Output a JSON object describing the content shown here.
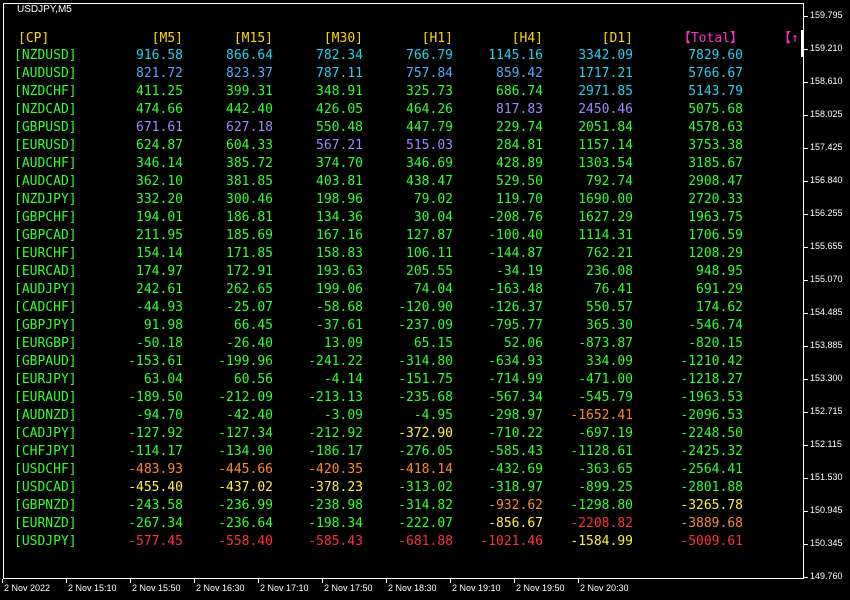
{
  "window": {
    "title": "USDJPY,M5"
  },
  "colors": {
    "header": "#ffd700",
    "total_header": "#ff33cc",
    "symbol": "#33ff33",
    "cyan": "#22d3ee",
    "blue": "#55aaff",
    "violet": "#9b8cff",
    "green": "#33ff33",
    "yellow": "#ffee44",
    "orange": "#ff8833",
    "red": "#ff3333",
    "white": "#ffffff"
  },
  "price_scale": [
    "159.795",
    "159.210",
    "158.610",
    "158.025",
    "157.425",
    "156.840",
    "156.255",
    "155.655",
    "155.070",
    "154.485",
    "153.885",
    "153.300",
    "152.715",
    "152.115",
    "151.530",
    "150.945",
    "150.345",
    "149.760"
  ],
  "time_scale": [
    "2 Nov 2022",
    "2 Nov 15:10",
    "2 Nov 15:50",
    "2 Nov 16:30",
    "2 Nov 17:10",
    "2 Nov 17:50",
    "2 Nov 18:30",
    "2 Nov 19:10",
    "2 Nov 19:50",
    "2 Nov 20:30"
  ],
  "table": {
    "headers": [
      "[CP]",
      "[M5]",
      "[M15]",
      "[M30]",
      "[H1]",
      "[H4]",
      "[D1]",
      "【Total】",
      "【↑"
    ],
    "rows": [
      {
        "symbol": "[NZDUSD]",
        "values": [
          "916.58",
          "866.64",
          "782.34",
          "766.79",
          "1145.16",
          "3342.09",
          "7829.60"
        ],
        "colors": [
          "cyan",
          "cyan",
          "cyan",
          "cyan",
          "cyan",
          "cyan",
          "cyan"
        ]
      },
      {
        "symbol": "[AUDUSD]",
        "values": [
          "821.72",
          "823.37",
          "787.11",
          "757.84",
          "859.42",
          "1717.21",
          "5766.67"
        ],
        "colors": [
          "blue",
          "blue",
          "cyan",
          "blue",
          "blue",
          "cyan",
          "cyan"
        ]
      },
      {
        "symbol": "[NZDCHF]",
        "values": [
          "411.25",
          "399.31",
          "348.91",
          "325.73",
          "686.74",
          "2971.85",
          "5143.79"
        ],
        "colors": [
          "green",
          "green",
          "green",
          "green",
          "green",
          "cyan",
          "cyan"
        ]
      },
      {
        "symbol": "[NZDCAD]",
        "values": [
          "474.66",
          "442.40",
          "426.05",
          "464.26",
          "817.83",
          "2450.46",
          "5075.68"
        ],
        "colors": [
          "green",
          "green",
          "green",
          "green",
          "violet",
          "violet",
          "green"
        ]
      },
      {
        "symbol": "[GBPUSD]",
        "values": [
          "671.61",
          "627.18",
          "550.48",
          "447.79",
          "229.74",
          "2051.84",
          "4578.63"
        ],
        "colors": [
          "violet",
          "violet",
          "green",
          "green",
          "green",
          "green",
          "green"
        ]
      },
      {
        "symbol": "[EURUSD]",
        "values": [
          "624.87",
          "604.33",
          "567.21",
          "515.03",
          "284.81",
          "1157.14",
          "3753.38"
        ],
        "colors": [
          "green",
          "green",
          "violet",
          "violet",
          "green",
          "green",
          "green"
        ]
      },
      {
        "symbol": "[AUDCHF]",
        "values": [
          "346.14",
          "385.72",
          "374.70",
          "346.69",
          "428.89",
          "1303.54",
          "3185.67"
        ],
        "colors": [
          "green",
          "green",
          "green",
          "green",
          "green",
          "green",
          "green"
        ]
      },
      {
        "symbol": "[AUDCAD]",
        "values": [
          "362.10",
          "381.85",
          "403.81",
          "438.47",
          "529.50",
          "792.74",
          "2908.47"
        ],
        "colors": [
          "green",
          "green",
          "green",
          "green",
          "green",
          "green",
          "green"
        ]
      },
      {
        "symbol": "[NZDJPY]",
        "values": [
          "332.20",
          "300.46",
          "198.96",
          "79.02",
          "119.70",
          "1690.00",
          "2720.33"
        ],
        "colors": [
          "green",
          "green",
          "green",
          "green",
          "green",
          "green",
          "green"
        ]
      },
      {
        "symbol": "[GBPCHF]",
        "values": [
          "194.01",
          "186.81",
          "134.36",
          "30.04",
          "-208.76",
          "1627.29",
          "1963.75"
        ],
        "colors": [
          "green",
          "green",
          "green",
          "green",
          "green",
          "green",
          "green"
        ]
      },
      {
        "symbol": "[GBPCAD]",
        "values": [
          "211.95",
          "185.69",
          "167.16",
          "127.87",
          "-100.40",
          "1114.31",
          "1706.59"
        ],
        "colors": [
          "green",
          "green",
          "green",
          "green",
          "green",
          "green",
          "green"
        ]
      },
      {
        "symbol": "[EURCHF]",
        "values": [
          "154.14",
          "171.85",
          "158.83",
          "106.11",
          "-144.87",
          "762.21",
          "1208.29"
        ],
        "colors": [
          "green",
          "green",
          "green",
          "green",
          "green",
          "green",
          "green"
        ]
      },
      {
        "symbol": "[EURCAD]",
        "values": [
          "174.97",
          "172.91",
          "193.63",
          "205.55",
          "-34.19",
          "236.08",
          "948.95"
        ],
        "colors": [
          "green",
          "green",
          "green",
          "green",
          "green",
          "green",
          "green"
        ]
      },
      {
        "symbol": "[AUDJPY]",
        "values": [
          "242.61",
          "262.65",
          "199.06",
          "74.04",
          "-163.48",
          "76.41",
          "691.29"
        ],
        "colors": [
          "green",
          "green",
          "green",
          "green",
          "green",
          "green",
          "green"
        ]
      },
      {
        "symbol": "[CADCHF]",
        "values": [
          "-44.93",
          "-25.07",
          "-58.68",
          "-120.90",
          "-126.37",
          "550.57",
          "174.62"
        ],
        "colors": [
          "green",
          "green",
          "green",
          "green",
          "green",
          "green",
          "green"
        ]
      },
      {
        "symbol": "[GBPJPY]",
        "values": [
          "91.98",
          "66.45",
          "-37.61",
          "-237.09",
          "-795.77",
          "365.30",
          "-546.74"
        ],
        "colors": [
          "green",
          "green",
          "green",
          "green",
          "green",
          "green",
          "green"
        ]
      },
      {
        "symbol": "[EURGBP]",
        "values": [
          "-50.18",
          "-26.40",
          "13.09",
          "65.15",
          "52.06",
          "-873.87",
          "-820.15"
        ],
        "colors": [
          "green",
          "green",
          "green",
          "green",
          "green",
          "green",
          "green"
        ]
      },
      {
        "symbol": "[GBPAUD]",
        "values": [
          "-153.61",
          "-199.96",
          "-241.22",
          "-314.80",
          "-634.93",
          "334.09",
          "-1210.42"
        ],
        "colors": [
          "green",
          "green",
          "green",
          "green",
          "green",
          "green",
          "green"
        ]
      },
      {
        "symbol": "[EURJPY]",
        "values": [
          "63.04",
          "60.56",
          "-4.14",
          "-151.75",
          "-714.99",
          "-471.00",
          "-1218.27"
        ],
        "colors": [
          "green",
          "green",
          "green",
          "green",
          "green",
          "green",
          "green"
        ]
      },
      {
        "symbol": "[EURAUD]",
        "values": [
          "-189.50",
          "-212.09",
          "-213.13",
          "-235.68",
          "-567.34",
          "-545.79",
          "-1963.53"
        ],
        "colors": [
          "green",
          "green",
          "green",
          "green",
          "green",
          "green",
          "green"
        ]
      },
      {
        "symbol": "[AUDNZD]",
        "values": [
          "-94.70",
          "-42.40",
          "-3.09",
          "-4.95",
          "-298.97",
          "-1652.41",
          "-2096.53"
        ],
        "colors": [
          "green",
          "green",
          "green",
          "green",
          "green",
          "orange",
          "green"
        ]
      },
      {
        "symbol": "[CADJPY]",
        "values": [
          "-127.92",
          "-127.34",
          "-212.92",
          "-372.90",
          "-710.22",
          "-697.19",
          "-2248.50"
        ],
        "colors": [
          "green",
          "green",
          "green",
          "yellow",
          "green",
          "green",
          "green"
        ]
      },
      {
        "symbol": "[CHFJPY]",
        "values": [
          "-114.17",
          "-134.90",
          "-186.17",
          "-276.05",
          "-585.43",
          "-1128.61",
          "-2425.32"
        ],
        "colors": [
          "green",
          "green",
          "green",
          "green",
          "green",
          "green",
          "green"
        ]
      },
      {
        "symbol": "[USDCHF]",
        "values": [
          "-483.93",
          "-445.66",
          "-420.35",
          "-418.14",
          "-432.69",
          "-363.65",
          "-2564.41"
        ],
        "colors": [
          "orange",
          "orange",
          "orange",
          "orange",
          "green",
          "green",
          "green"
        ]
      },
      {
        "symbol": "[USDCAD]",
        "values": [
          "-455.40",
          "-437.02",
          "-378.23",
          "-313.02",
          "-318.97",
          "-899.25",
          "-2801.88"
        ],
        "colors": [
          "yellow",
          "yellow",
          "yellow",
          "green",
          "green",
          "green",
          "green"
        ]
      },
      {
        "symbol": "[GBPNZD]",
        "values": [
          "-243.58",
          "-236.99",
          "-238.98",
          "-314.82",
          "-932.62",
          "-1298.80",
          "-3265.78"
        ],
        "colors": [
          "green",
          "green",
          "green",
          "green",
          "orange",
          "green",
          "yellow"
        ]
      },
      {
        "symbol": "[EURNZD]",
        "values": [
          "-267.34",
          "-236.64",
          "-198.34",
          "-222.07",
          "-856.67",
          "-2208.82",
          "-3889.68"
        ],
        "colors": [
          "green",
          "green",
          "green",
          "green",
          "yellow",
          "red",
          "orange"
        ]
      },
      {
        "symbol": "[USDJPY]",
        "values": [
          "-577.45",
          "-558.40",
          "-585.43",
          "-681.88",
          "-1021.46",
          "-1584.99",
          "-5009.61"
        ],
        "colors": [
          "red",
          "red",
          "red",
          "red",
          "red",
          "yellow",
          "red"
        ]
      }
    ]
  }
}
